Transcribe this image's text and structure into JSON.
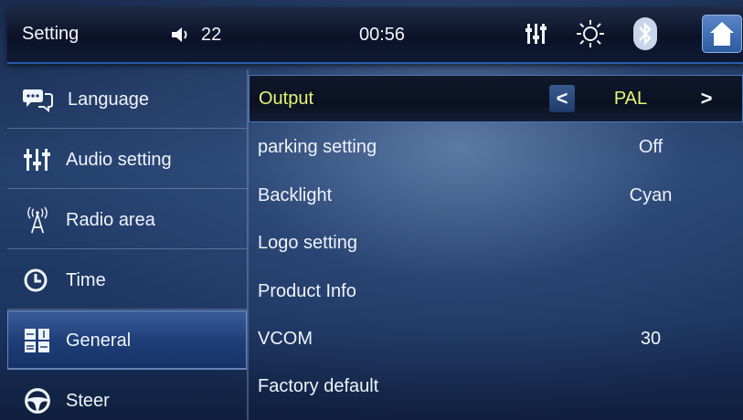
{
  "statusbar": {
    "title": "Setting",
    "volume": "22",
    "time": "00:56",
    "icons": [
      "speaker-icon",
      "equalizer-icon",
      "brightness-icon",
      "bluetooth-icon",
      "home-icon"
    ]
  },
  "sidebar": {
    "items": [
      {
        "label": "Language",
        "icon": "speech-bubble-icon",
        "active": false
      },
      {
        "label": "Audio setting",
        "icon": "equalizer-icon",
        "active": false
      },
      {
        "label": "Radio area",
        "icon": "antenna-icon",
        "active": false
      },
      {
        "label": "Time",
        "icon": "clock-icon",
        "active": false
      },
      {
        "label": "General",
        "icon": "grid-icon",
        "active": true
      },
      {
        "label": "Steer",
        "icon": "steering-wheel-icon",
        "active": false
      }
    ]
  },
  "settings": {
    "rows": [
      {
        "label": "Output",
        "value": "PAL",
        "selected": true
      },
      {
        "label": "parking setting",
        "value": "Off"
      },
      {
        "label": "Backlight",
        "value": "Cyan"
      },
      {
        "label": "Logo setting",
        "value": ""
      },
      {
        "label": "Product Info",
        "value": ""
      },
      {
        "label": "VCOM",
        "value": "30"
      },
      {
        "label": "Factory default",
        "value": ""
      }
    ],
    "prev_arrow": "<",
    "next_arrow": ">"
  },
  "colors": {
    "selected_text": "#e8f57a",
    "accent": "#4d78b8"
  }
}
